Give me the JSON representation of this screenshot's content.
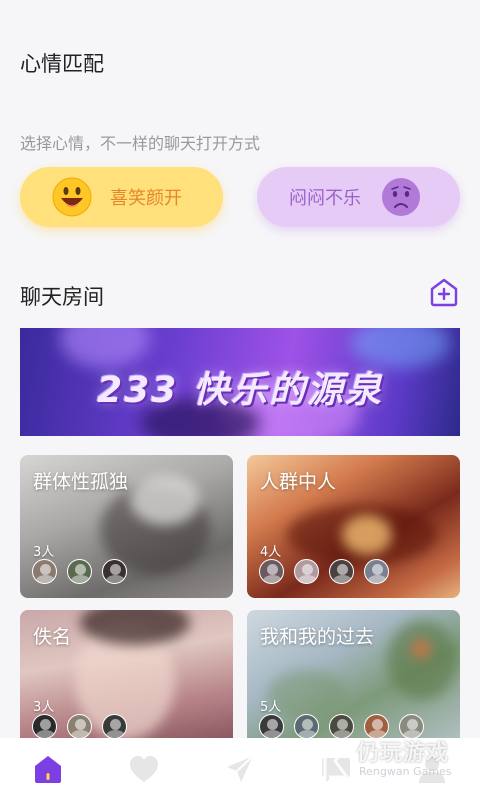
{
  "mood": {
    "title": "心情匹配",
    "subtitle": "选择心情，不一样的聊天打开方式",
    "happy_label": "喜笑颜开",
    "sad_label": "闷闷不乐"
  },
  "rooms": {
    "title": "聊天房间",
    "banner_text": "233 快乐的源泉",
    "cards": [
      {
        "name": "群体性孤独",
        "count": "3人"
      },
      {
        "name": "人群中人",
        "count": "4人"
      },
      {
        "name": "佚名",
        "count": "3人"
      },
      {
        "name": "我和我的过去",
        "count": "5人"
      }
    ]
  },
  "tabs": [
    {
      "icon": "home-icon",
      "active": true
    },
    {
      "icon": "heart-icon",
      "active": false
    },
    {
      "icon": "send-icon",
      "active": false
    },
    {
      "icon": "chat-icon",
      "active": false
    },
    {
      "icon": "profile-icon",
      "active": false
    }
  ],
  "watermark": {
    "title": "仍玩游戏",
    "subtitle": "Rengwan Games"
  },
  "colors": {
    "accent": "#7b3fe4",
    "happy_bg": "#ffe07a",
    "happy_text": "#e6862a",
    "sad_bg": "#e6cbf7",
    "sad_text": "#9a63c9",
    "tab_inactive": "#e6e6e6"
  }
}
